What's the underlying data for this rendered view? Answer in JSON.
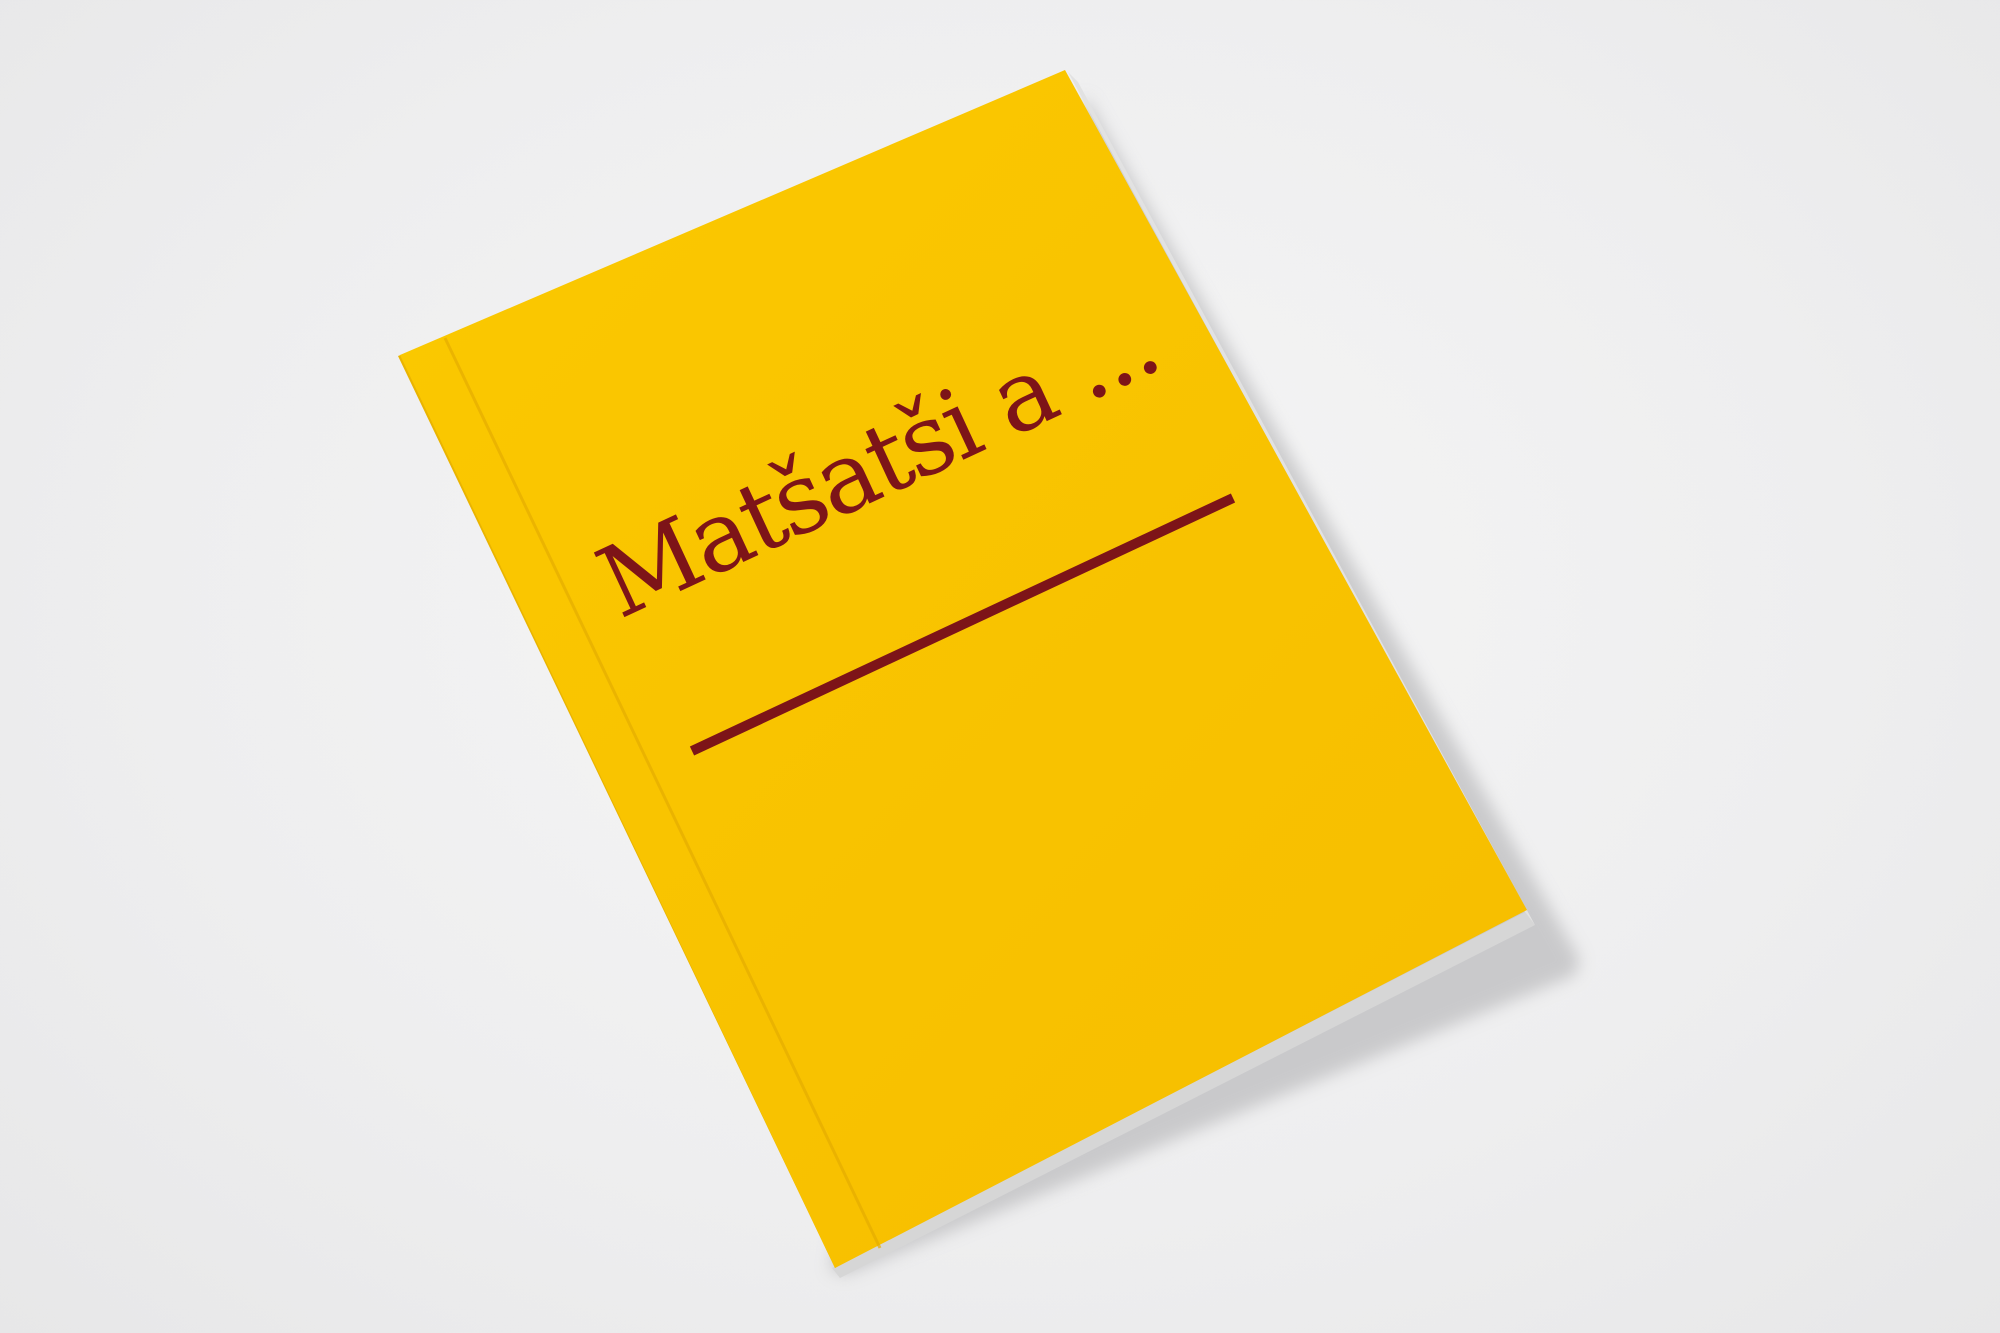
{
  "photo": {
    "background_color": "#efefef",
    "book": {
      "cover_color": "#f9c300",
      "spine_color": "#e8b200",
      "ink_color": "#7d1418",
      "page_edge_color": "#d9d9d9"
    }
  },
  "cover": {
    "title": "Matšatši a ..."
  }
}
